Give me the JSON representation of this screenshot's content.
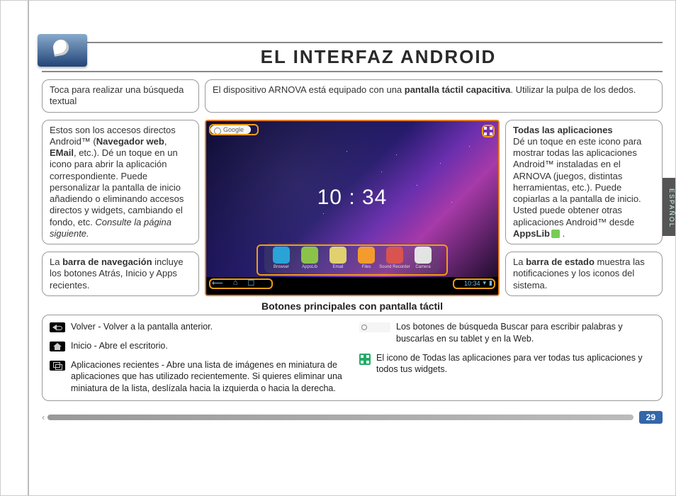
{
  "page_number": "29",
  "language_tab": "ESPAÑOL",
  "title": "EL INTERFAZ ANDROID",
  "callouts": {
    "search_tip": "Toca para realizar una búsqueda textual",
    "touchscreen_info_1": "El dispositivo ARNOVA está equipado con una ",
    "touchscreen_info_bold": "pantalla táctil capacitiva",
    "touchscreen_info_2": ". Utilizar la pulpa de los dedos.",
    "shortcuts_1": "Estos son los accesos directos Android™ (",
    "shortcuts_b1": "Navegador web",
    "shortcuts_sep": ", ",
    "shortcuts_b2": "EMail",
    "shortcuts_2": ", etc.). Dé un toque en un icono para abrir la aplicación correspondiente. Puede personalizar la pantalla de inicio añadiendo o eliminando accesos directos y widgets, cambiando el fondo, etc. ",
    "shortcuts_i": "Consulte la página siguiente.",
    "navbar_1": "La ",
    "navbar_b": "barra de navegación",
    "navbar_2": " incluye los botones Atrás, Inicio y Apps recientes.",
    "allapps_title": "Todas las aplicaciones",
    "allapps_body_1": "Dé un toque en este icono para mostrar todas las aplicaciones Android™ instaladas en el ARNOVA (juegos, distintas herramientas, etc.). Puede copiarlas a la pantalla de inicio. Usted puede obtener otras aplicaciones Android™ desde ",
    "allapps_body_b": "AppsLib",
    "allapps_body_2": " .",
    "statusbar_1": "La ",
    "statusbar_b": "barra de estado",
    "statusbar_2": " muestra las notificaciones y los iconos del sistema."
  },
  "screenshot": {
    "google_label": "Google",
    "dock": [
      {
        "label": "Browser",
        "color": "#2aa3d6"
      },
      {
        "label": "AppsLib",
        "color": "#8bc34a"
      },
      {
        "label": "Email",
        "color": "#e0d070"
      },
      {
        "label": "Files",
        "color": "#f49b2e"
      },
      {
        "label": "Sound Recorder",
        "color": "#d9534f"
      },
      {
        "label": "Camera",
        "color": "#e3e3e3"
      }
    ],
    "clock_time": "10 : 34",
    "clock_date": "",
    "nav_time": "10:34"
  },
  "section_heading": "Botones principales con pantalla táctil",
  "buttons": {
    "back": "Volver - Volver a la pantalla anterior.",
    "home": "Inicio - Abre el escritorio.",
    "recent": "Aplicaciones recientes - Abre una lista de imágenes en miniatura de aplicaciones que has utilizado recientemente. Si quieres eliminar una miniatura de la lista, deslízala hacia la izquierda o hacia la derecha.",
    "google": "Los botones de búsqueda Buscar para escribir palabras y buscarlas en su tablet y en la Web.",
    "apps": "El icono de Todas las aplicaciones para ver todas tus aplicaciones y todos tus widgets."
  }
}
